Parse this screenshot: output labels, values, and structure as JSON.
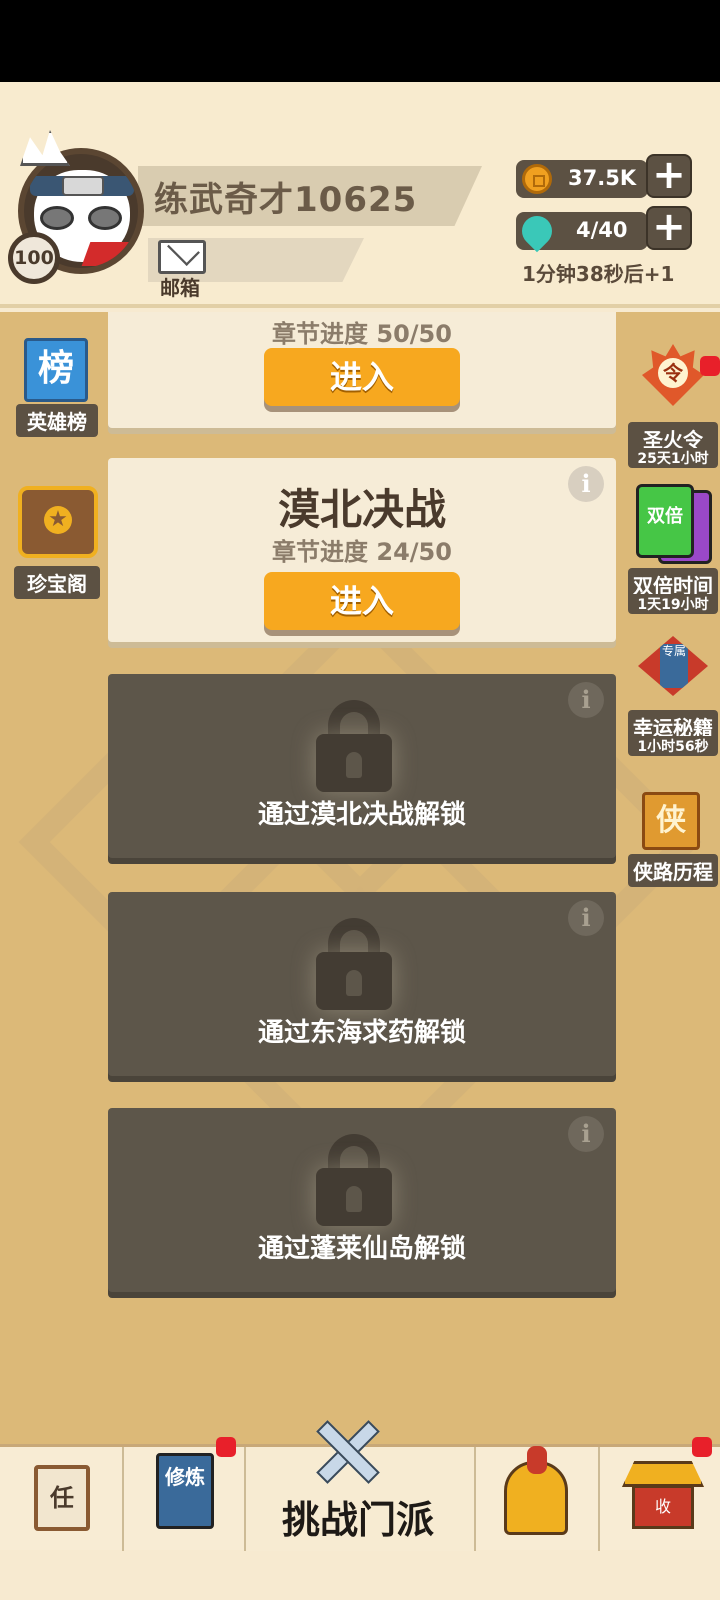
{
  "profile": {
    "name": "练武奇才10625",
    "level": "100",
    "mail_label": "邮箱"
  },
  "currency": {
    "coins": "37.5K",
    "energy": "4/40",
    "energy_timer": "1分钟38秒后+1",
    "add_label": "+"
  },
  "side_left": [
    {
      "label": "英雄榜",
      "icon": "榜"
    },
    {
      "label": "珍宝阁",
      "icon": "treasure-chest"
    }
  ],
  "side_right": [
    {
      "label": "圣火令",
      "sub": "25天1小时",
      "icon": "令"
    },
    {
      "label": "双倍时间",
      "sub": "1天19小时",
      "icon": "双倍"
    },
    {
      "label": "幸运秘籍",
      "sub": "1小时56秒",
      "icon": "专属"
    },
    {
      "label": "侠路历程",
      "icon": "侠"
    }
  ],
  "chapters": [
    {
      "progress": "章节进度 50/50",
      "button": "进入"
    },
    {
      "title": "漠北决战",
      "progress": "章节进度 24/50",
      "button": "进入",
      "info": "i"
    },
    {
      "locked_text": "通过漠北决战解锁",
      "info": "i"
    },
    {
      "locked_text": "通过东海求药解锁",
      "info": "i"
    },
    {
      "locked_text": "通过蓬莱仙岛解锁",
      "info": "i"
    }
  ],
  "bottom_nav": {
    "tasks_icon": "任",
    "train_icon": "修炼",
    "challenge_label": "挑战门派",
    "collect_icon": "收"
  },
  "colors": {
    "accent_button": "#f7a81f",
    "locked_card": "#5d564a",
    "badge_red": "#e8202a"
  }
}
